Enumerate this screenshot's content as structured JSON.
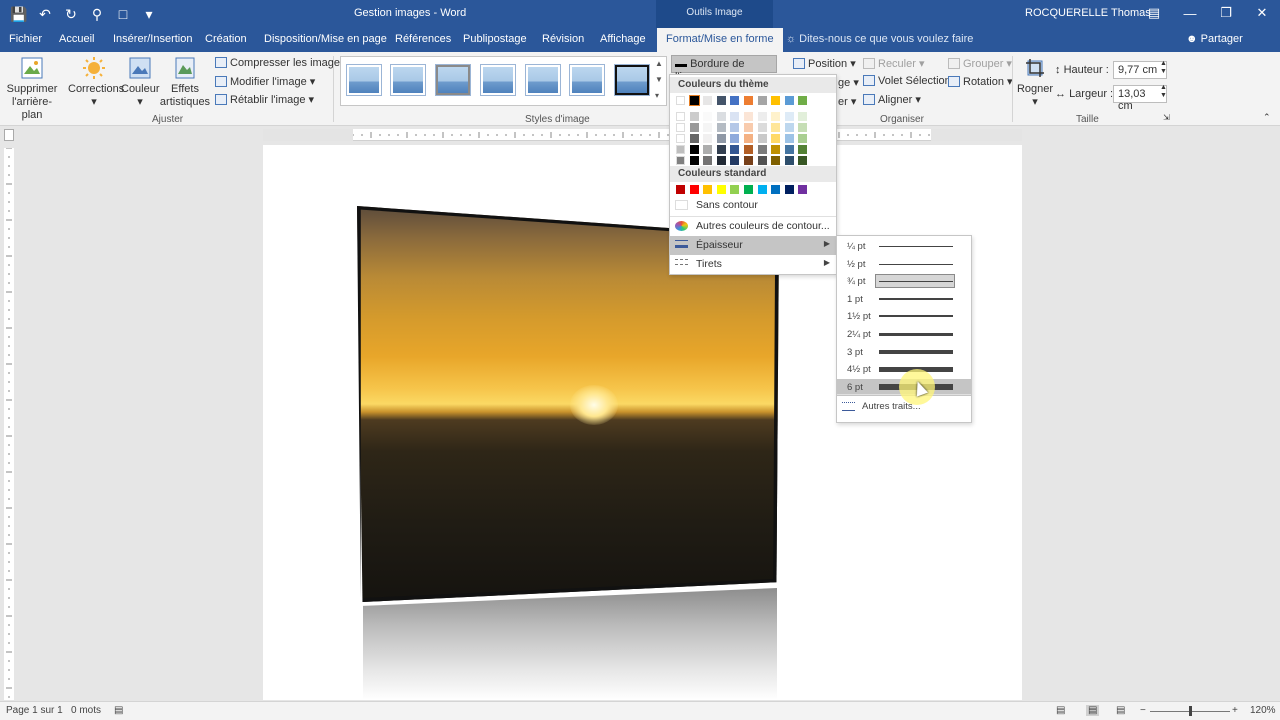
{
  "window": {
    "title": "Gestion images  -  Word",
    "context_tools": "Outils Image",
    "user": "ROCQUERELLE Thomas",
    "qat_icons": [
      "save-icon",
      "undo-icon",
      "redo-icon",
      "print-preview-icon",
      "new-document-icon",
      "customize-qat-icon"
    ]
  },
  "tabs": [
    {
      "label": "Fichier"
    },
    {
      "label": "Accueil"
    },
    {
      "label": "Insérer/Insertion"
    },
    {
      "label": "Création"
    },
    {
      "label": "Disposition/Mise en page"
    },
    {
      "label": "Références"
    },
    {
      "label": "Publipostage"
    },
    {
      "label": "Révision"
    },
    {
      "label": "Affichage"
    },
    {
      "label": "Format/Mise en forme",
      "active": true
    }
  ],
  "tell_me": "Dites-nous ce que vous voulez faire",
  "share": "Partager",
  "ribbon": {
    "remove_bg": {
      "line1": "Supprimer",
      "line2": "l'arrière-plan"
    },
    "corrections": "Corrections",
    "color": "Couleur",
    "artistic": {
      "line1": "Effets",
      "line2": "artistiques"
    },
    "compress": "Compresser les images",
    "modify": "Modifier l'image",
    "reset": "Rétablir l'image",
    "group_adjust": "Ajuster",
    "group_styles": "Styles d'image",
    "border_button": "Bordure de l'image",
    "position": "Position",
    "wrap_partial": "ge",
    "bring_forward": "Reculer",
    "selection_pane": "Volet Sélection",
    "group_btn": "Grouper",
    "rotate": "Rotation",
    "align": "Aligner",
    "send_partial": "er",
    "group_arrange": "Organiser",
    "crop": "Rogner",
    "height_label": "Hauteur :",
    "height_value": "9,77 cm",
    "width_label": "Largeur :",
    "width_value": "13,03 cm",
    "group_size": "Taille"
  },
  "border_menu": {
    "theme_header": "Couleurs du thème",
    "standard_header": "Couleurs standard",
    "no_outline": "Sans contour",
    "more_colors": "Autres couleurs de contour...",
    "weight": "Épaisseur",
    "dashes": "Tirets",
    "theme_colors": [
      "#ffffff",
      "#000000",
      "#e7e6e6",
      "#44546a",
      "#4472c4",
      "#ed7d31",
      "#a5a5a5",
      "#ffc000",
      "#5b9bd5",
      "#70ad47"
    ],
    "standard_colors": [
      "#c00000",
      "#ff0000",
      "#ffc000",
      "#ffff00",
      "#92d050",
      "#00b050",
      "#00b0f0",
      "#0070c0",
      "#002060",
      "#7030a0"
    ]
  },
  "weight_menu": {
    "items": [
      {
        "label": "¼ pt",
        "thickness": 1
      },
      {
        "label": "½ pt",
        "thickness": 1
      },
      {
        "label": "¾ pt",
        "thickness": 1,
        "selected": true
      },
      {
        "label": "1 pt",
        "thickness": 2
      },
      {
        "label": "1½ pt",
        "thickness": 2
      },
      {
        "label": "2¼ pt",
        "thickness": 3
      },
      {
        "label": "3 pt",
        "thickness": 4
      },
      {
        "label": "4½ pt",
        "thickness": 5
      },
      {
        "label": "6 pt",
        "thickness": 6,
        "hover": true
      }
    ],
    "more_lines": "Autres traits..."
  },
  "status": {
    "page": "Page 1 sur 1",
    "words": "0 mots",
    "zoom": "120%"
  }
}
